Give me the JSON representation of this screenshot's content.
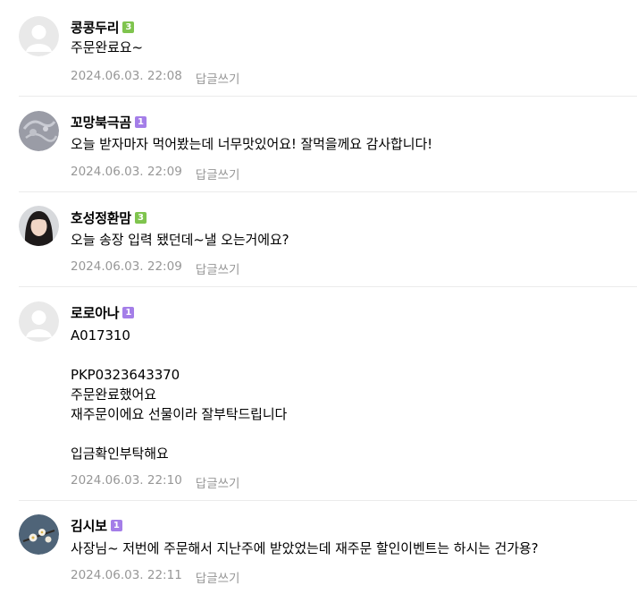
{
  "badge_colors": {
    "level3": "#7fc44e",
    "level1": "#a47ee8"
  },
  "comments": [
    {
      "nickname": "콩콩두리",
      "level": "3",
      "avatar": "default-avatar-icon",
      "text": "주문완료요~",
      "date": "2024.06.03. 22:08",
      "reply_label": "답글쓰기"
    },
    {
      "nickname": "꼬망북극곰",
      "level": "1",
      "avatar": "sketch-photo-avatar",
      "text": "오늘 받자마자 먹어봤는데 너무맛있어요! 잘먹을께요 감사합니다!",
      "date": "2024.06.03. 22:09",
      "reply_label": "답글쓰기"
    },
    {
      "nickname": "호성정환맘",
      "level": "3",
      "avatar": "portrait-photo-avatar",
      "text": "오늘 송장 입력 됐던데~낼 오는거에요?",
      "date": "2024.06.03. 22:09",
      "reply_label": "답글쓰기"
    },
    {
      "nickname": "로로아나",
      "level": "1",
      "avatar": "default-avatar-icon",
      "text": "A017310\n\nPKP0323643370\n주문완료했어요\n재주문이에요 선물이라 잘부탁드립니다\n\n입금확인부탁해요",
      "date": "2024.06.03. 22:10",
      "reply_label": "답글쓰기"
    },
    {
      "nickname": "김시보",
      "level": "1",
      "avatar": "flower-photo-avatar",
      "text": "사장님~ 저번에 주문해서 지난주에 받았었는데 재주문 할인이벤트는 하시는 건가용?",
      "date": "2024.06.03. 22:11",
      "reply_label": "답글쓰기"
    }
  ]
}
